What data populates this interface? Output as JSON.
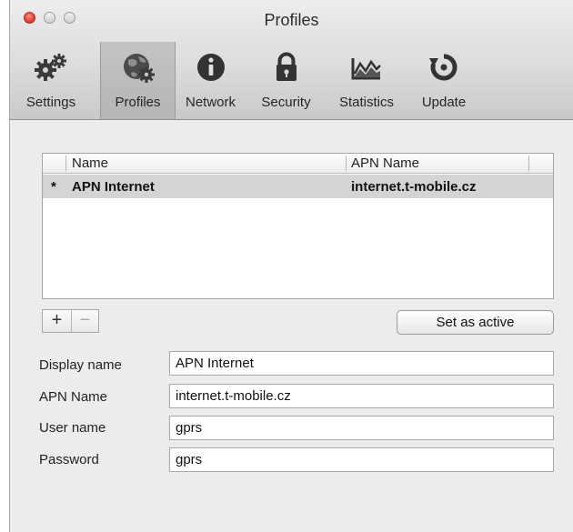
{
  "window": {
    "title": "Profiles"
  },
  "toolbar": {
    "items": [
      {
        "label": "Settings",
        "icon": "gears-icon"
      },
      {
        "label": "Profiles",
        "icon": "globe-gear-icon",
        "selected": true
      },
      {
        "label": "Network",
        "icon": "info-icon"
      },
      {
        "label": "Security",
        "icon": "lock-icon"
      },
      {
        "label": "Statistics",
        "icon": "chart-icon"
      },
      {
        "label": "Update",
        "icon": "refresh-icon"
      }
    ]
  },
  "profiles_table": {
    "columns": [
      "Name",
      "APN Name"
    ],
    "rows": [
      {
        "active_marker": "*",
        "name": "APN Internet",
        "apn": "internet.t-mobile.cz",
        "selected": true
      }
    ]
  },
  "list_buttons": {
    "add": "+",
    "remove": "−"
  },
  "set_active_label": "Set as active",
  "form": {
    "display_name": {
      "label": "Display name",
      "value": "APN Internet"
    },
    "apn_name": {
      "label": "APN Name",
      "value": "internet.t-mobile.cz"
    },
    "user_name": {
      "label": "User name",
      "value": "gprs"
    },
    "password": {
      "label": "Password",
      "value": "gprs"
    }
  },
  "colors": {
    "close_button": "#e0453a",
    "selected_row": "#d4d4d4",
    "window_bg": "#ececec"
  }
}
